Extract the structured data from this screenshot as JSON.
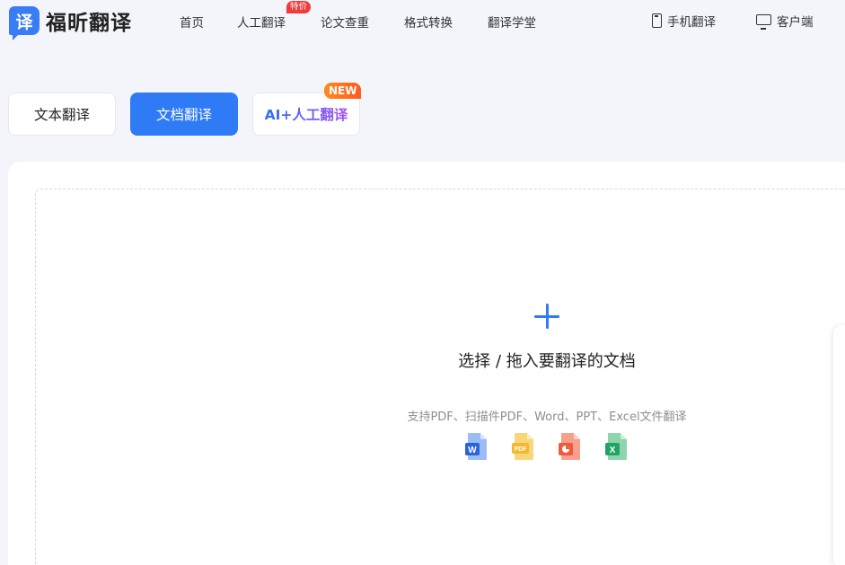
{
  "logo": {
    "mark": "译",
    "text": "福昕翻译"
  },
  "nav": {
    "items": [
      {
        "label": "首页"
      },
      {
        "label": "人工翻译",
        "badge": "特价"
      },
      {
        "label": "论文查重"
      },
      {
        "label": "格式转换"
      },
      {
        "label": "翻译学堂"
      }
    ],
    "mobile_label": "手机翻译",
    "desktop_label": "客户端"
  },
  "tabs": {
    "text_label": "文本翻译",
    "doc_label": "文档翻译",
    "ai_label": "AI+人工翻译",
    "ai_badge": "NEW",
    "active": "doc"
  },
  "upload": {
    "title": "选择 / 拖入要翻译的文档",
    "subtitle": "支持PDF、扫描件PDF、Word、PPT、Excel文件翻译",
    "file_types": [
      {
        "icon": "word-file-icon",
        "label": "W",
        "color": "#2b63d9"
      },
      {
        "icon": "pdf-file-icon",
        "label": "PDF",
        "color": "#f5b82e"
      },
      {
        "icon": "ppt-file-icon",
        "label": "P",
        "color": "#ee5b3c"
      },
      {
        "icon": "excel-file-icon",
        "label": "X",
        "color": "#21a366"
      }
    ]
  },
  "colors": {
    "accent": "#2f7bf5",
    "badge_red": "#ef3b3b",
    "badge_orange": "#ff7a1f"
  }
}
